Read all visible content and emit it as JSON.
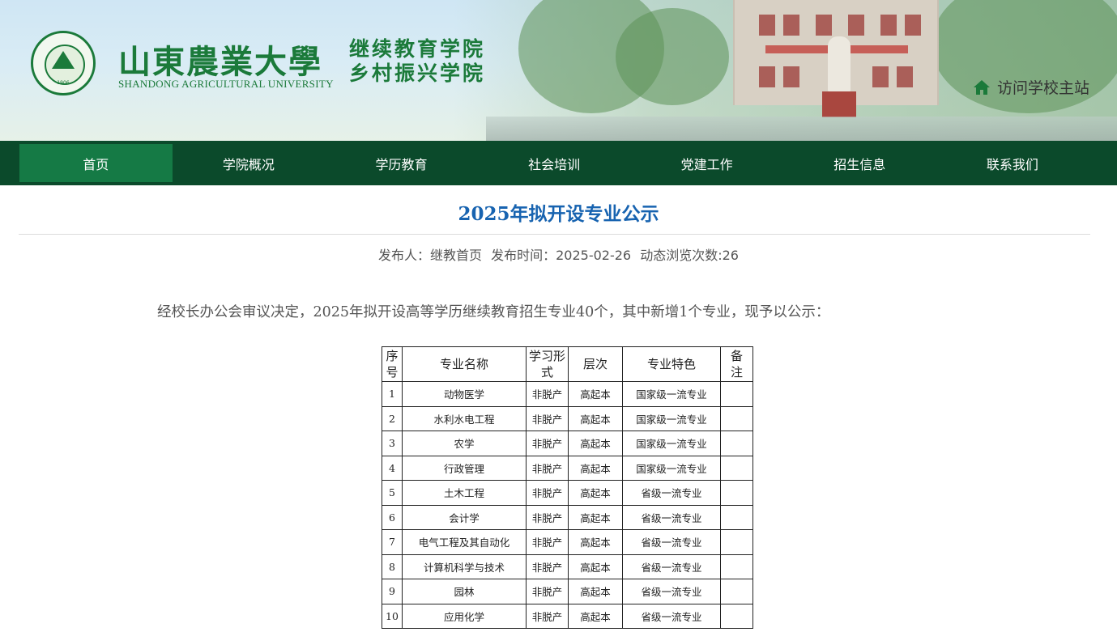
{
  "header": {
    "school_name_cn": "山東農業大學",
    "school_name_en": "SHANDONG AGRICULTURAL UNIVERSITY",
    "seal_year": "1906",
    "college_line1": "继续教育学院",
    "college_line2": "乡村振兴学院",
    "visit_main_site": "访问学校主站",
    "visit_icon": "home-icon",
    "brand_color": "#1b7a3a"
  },
  "nav": {
    "items": [
      "首页",
      "学院概况",
      "学历教育",
      "社会培训",
      "党建工作",
      "招生信息",
      "联系我们"
    ],
    "active_index": 0,
    "bg_color": "#0b4a2b",
    "active_color": "#157a45"
  },
  "article": {
    "title": "2025年拟开设专业公示",
    "publisher_label": "发布人：继教首页",
    "date_label": "发布时间：2025-02-26",
    "views_label": "动态浏览次数:26",
    "intro": "经校长办公会审议决定，2025年拟开设高等学历继续教育招生专业40个，其中新增1个专业，现予以公示：",
    "title_color": "#1763b0"
  },
  "table": {
    "headers": [
      "序号",
      "专业名称",
      "学习形式",
      "层次",
      "专业特色",
      "备注"
    ],
    "rows": [
      [
        "1",
        "动物医学",
        "非脱产",
        "高起本",
        "国家级一流专业",
        ""
      ],
      [
        "2",
        "水利水电工程",
        "非脱产",
        "高起本",
        "国家级一流专业",
        ""
      ],
      [
        "3",
        "农学",
        "非脱产",
        "高起本",
        "国家级一流专业",
        ""
      ],
      [
        "4",
        "行政管理",
        "非脱产",
        "高起本",
        "国家级一流专业",
        ""
      ],
      [
        "5",
        "土木工程",
        "非脱产",
        "高起本",
        "省级一流专业",
        ""
      ],
      [
        "6",
        "会计学",
        "非脱产",
        "高起本",
        "省级一流专业",
        ""
      ],
      [
        "7",
        "电气工程及其自动化",
        "非脱产",
        "高起本",
        "省级一流专业",
        ""
      ],
      [
        "8",
        "计算机科学与技术",
        "非脱产",
        "高起本",
        "省级一流专业",
        ""
      ],
      [
        "9",
        "园林",
        "非脱产",
        "高起本",
        "省级一流专业",
        ""
      ],
      [
        "10",
        "应用化学",
        "非脱产",
        "高起本",
        "省级一流专业",
        ""
      ]
    ]
  }
}
